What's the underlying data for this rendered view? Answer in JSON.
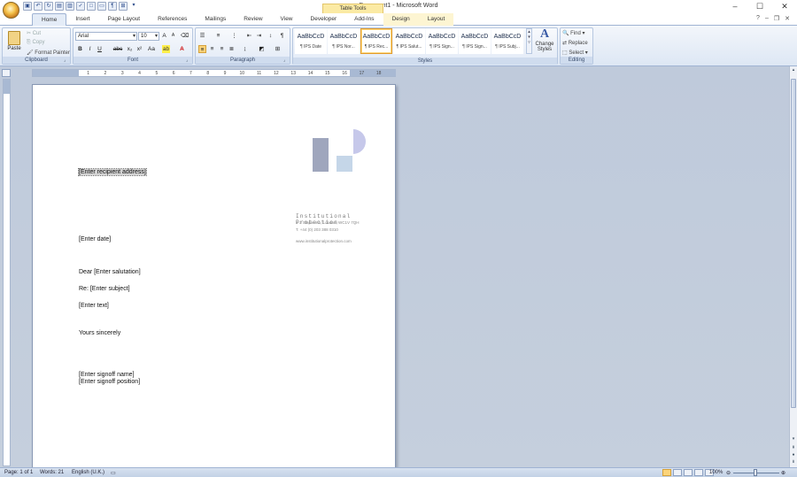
{
  "window": {
    "title": "Document1 - Microsoft Word",
    "context_tab": "Table Tools"
  },
  "qat": {
    "items": [
      "save-icon",
      "undo-icon",
      "redo-icon",
      "print-icon",
      "preview-icon",
      "spelling-icon",
      "new-icon",
      "open-icon",
      "show-marks-icon",
      "draw-table-icon",
      "customize-icon"
    ]
  },
  "tabs": [
    "Home",
    "Insert",
    "Page Layout",
    "References",
    "Mailings",
    "Review",
    "View",
    "Developer",
    "Add-Ins",
    "Design",
    "Layout"
  ],
  "clipboard": {
    "paste": "Paste",
    "cut": "Cut",
    "copy": "Copy",
    "format_painter": "Format Painter",
    "label": "Clipboard"
  },
  "font": {
    "name": "Arial",
    "size": "10",
    "label": "Font",
    "bold": "B",
    "italic": "I",
    "underline": "U",
    "strike": "abc",
    "sub": "x₂",
    "sup": "x²",
    "case": "Aa",
    "grow": "A",
    "shrink": "A"
  },
  "paragraph": {
    "label": "Paragraph",
    "pilcrow": "¶"
  },
  "styles": {
    "label": "Styles",
    "items": [
      {
        "preview": "AaBbCcD",
        "name": "¶ IPS Date"
      },
      {
        "preview": "AaBbCcD",
        "name": "¶ IPS Nor..."
      },
      {
        "preview": "AaBbCcD",
        "name": "¶ IPS Rec..."
      },
      {
        "preview": "AaBbCcD",
        "name": "¶ IPS Salut..."
      },
      {
        "preview": "AaBbCcD",
        "name": "¶ IPS Sign..."
      },
      {
        "preview": "AaBbCcD",
        "name": "¶ IPS Sign..."
      },
      {
        "preview": "AaBbCcD",
        "name": "¶ IPS Subj..."
      }
    ],
    "change_styles_line1": "Change",
    "change_styles_line2": "Styles"
  },
  "editing": {
    "label": "Editing",
    "find": "Find",
    "replace": "Replace",
    "select": "Select"
  },
  "ruler": {
    "ticks": [
      "1",
      "2",
      "3",
      "4",
      "5",
      "6",
      "7",
      "8",
      "9",
      "10",
      "11",
      "12",
      "13",
      "14",
      "15",
      "16",
      "17",
      "18"
    ]
  },
  "document": {
    "recipient": "[Enter recipient address]",
    "date": "[Enter date]",
    "salutation": "Dear [Enter salutation]",
    "subject": "Re: [Enter subject]",
    "text": "[Enter text]",
    "closing": "Yours sincerely",
    "signoff_name": "[Enter signoff name]",
    "signoff_position": "[Enter signoff position]",
    "company": "Institutional Protection",
    "address": "1-3 Staple Inn, London, WC1V 7QH",
    "phone": "T. +44 (0) 203 388 0310",
    "website": "www.institutionalprotection.com"
  },
  "status": {
    "page": "Page: 1 of 1",
    "words": "Words: 21",
    "language": "English (U.K.)",
    "zoom": "100%"
  },
  "colors": {
    "accent": "#3a5ba6",
    "logo_gray": "#9fa6bd",
    "logo_lavender": "#c6c8ea",
    "logo_blue": "#c5d6e8"
  }
}
